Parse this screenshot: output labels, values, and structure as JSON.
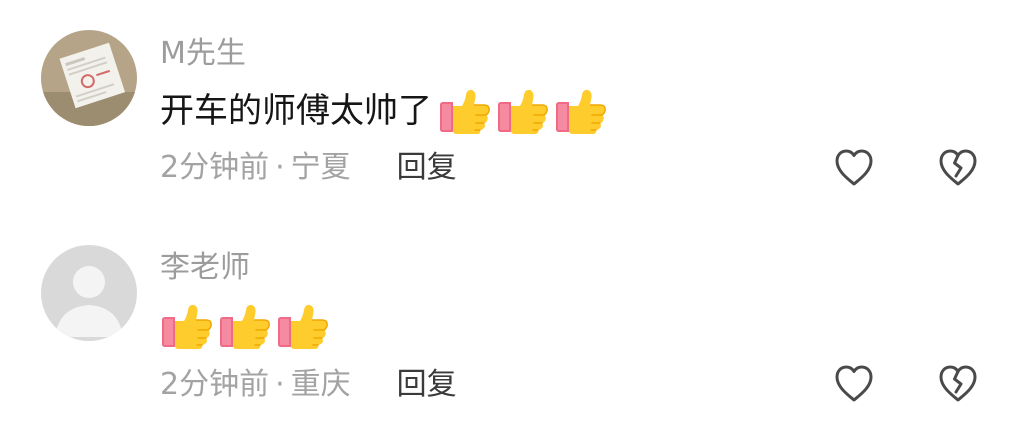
{
  "comments": [
    {
      "username": "M先生",
      "text": "开车的师傅太帅了",
      "thumbs_count": 3,
      "time": "2分钟前",
      "separator": "·",
      "location": "宁夏",
      "reply_label": "回复",
      "avatar": "document-photo-avatar"
    },
    {
      "username": "李老师",
      "text": "",
      "thumbs_count": 3,
      "time": "2分钟前",
      "separator": "·",
      "location": "重庆",
      "reply_label": "回复",
      "avatar": "default-gray-avatar"
    }
  ],
  "icons": {
    "like": "heart-outline-icon",
    "dislike": "broken-heart-outline-icon",
    "emoji": "thumbs-up-emoji"
  },
  "colors": {
    "username": "#9c9c9c",
    "text": "#161616",
    "meta": "#a3a3a3",
    "reply": "#3a3a3a",
    "icon_stroke": "#4a4a4a"
  }
}
